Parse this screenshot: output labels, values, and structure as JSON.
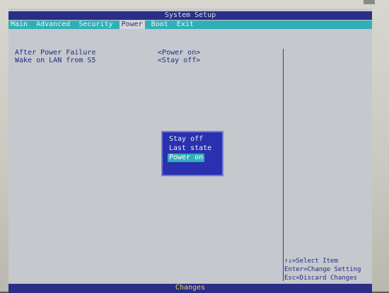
{
  "title": "System Setup",
  "menu": {
    "tabs": [
      {
        "label": "Main"
      },
      {
        "label": "Advanced"
      },
      {
        "label": "Security"
      },
      {
        "label": "Power"
      },
      {
        "label": "Boot"
      },
      {
        "label": "Exit"
      }
    ],
    "active_index": 3
  },
  "settings": [
    {
      "label": "After Power Failure",
      "value": "<Power on>"
    },
    {
      "label": "Wake on LAN from S5",
      "value": "<Stay off>"
    }
  ],
  "popup": {
    "options": [
      "Stay off",
      "Last state",
      "Power on"
    ],
    "selected_index": 2
  },
  "help": {
    "select_item": "↑↓=Select Item",
    "change_setting": "Enter=Change Setting",
    "discard_changes": "Esc=Discard Changes"
  },
  "bottom_bar": {
    "text": "Changes"
  },
  "colors": {
    "bios_blue": "#2b2d86",
    "menu_cyan": "#2fb0b8",
    "screen_gray": "#c5c8cc",
    "text_blue": "#262b86",
    "bottom_text": "#e6d25a"
  }
}
